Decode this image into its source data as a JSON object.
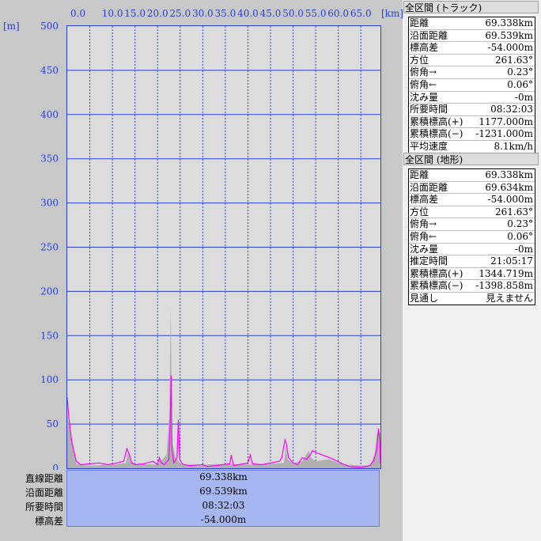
{
  "chart_data": {
    "type": "area",
    "xlabel": "[km]",
    "ylabel": "[m]",
    "xlim": [
      0,
      69.338
    ],
    "ylim": [
      0,
      500
    ],
    "xticks": [
      "0.0",
      "10.0",
      "15.0",
      "20.0",
      "25.0",
      "30.0",
      "35.0",
      "40.0",
      "45.0",
      "50.0",
      "55.0",
      "60.0",
      "65.0"
    ],
    "yticks": [
      "500",
      "450",
      "400",
      "350",
      "300",
      "250",
      "200",
      "150",
      "100",
      "50",
      "0"
    ],
    "grid": true,
    "series": [
      {
        "name": "",
        "color": "#b0b0b0",
        "x": [
          0,
          2,
          5,
          10,
          13,
          13.5,
          14,
          15,
          20,
          22,
          22.6,
          22.9,
          23.2,
          24,
          25,
          26,
          30,
          35,
          40,
          45,
          48,
          48.4,
          48.8,
          50,
          52,
          53.5,
          54,
          55,
          58,
          60,
          62,
          65,
          67,
          68,
          68.6,
          69.338
        ],
        "y": [
          60,
          5,
          3,
          4,
          6,
          20,
          8,
          5,
          4,
          15,
          60,
          185,
          30,
          12,
          6,
          4,
          4,
          5,
          4,
          5,
          6,
          25,
          10,
          6,
          8,
          20,
          12,
          8,
          10,
          6,
          4,
          3,
          3,
          15,
          40,
          40
        ]
      },
      {
        "name": "",
        "color": "#ff00ff",
        "x": [
          0,
          0.3,
          1,
          2,
          3,
          5,
          7,
          9,
          11,
          12.5,
          13.2,
          13.8,
          14.3,
          15,
          17,
          19,
          20,
          20.4,
          20.8,
          21.5,
          22.5,
          22.8,
          23.0,
          23.2,
          23.6,
          24.3,
          24.6,
          24.9,
          25.5,
          26,
          27,
          30,
          31,
          33,
          36,
          36.3,
          36.8,
          38,
          40,
          40.5,
          41,
          43,
          45,
          47,
          47.5,
          48.2,
          48.5,
          49,
          50,
          51,
          52,
          53,
          53.8,
          54.3,
          55,
          57,
          59,
          60.5,
          61.5,
          62.5,
          65,
          67,
          67.8,
          68.5,
          68.9,
          69.2,
          69.338
        ],
        "y": [
          80,
          60,
          30,
          8,
          4,
          5,
          6,
          4,
          6,
          8,
          22,
          15,
          6,
          4,
          5,
          8,
          4,
          12,
          6,
          4,
          10,
          50,
          105,
          20,
          6,
          12,
          55,
          10,
          5,
          4,
          3,
          4,
          2,
          3,
          5,
          15,
          3,
          4,
          6,
          15,
          5,
          4,
          6,
          8,
          12,
          32,
          28,
          12,
          6,
          4,
          12,
          10,
          15,
          20,
          18,
          14,
          10,
          6,
          4,
          2,
          1,
          3,
          8,
          20,
          45,
          30,
          5
        ]
      }
    ]
  },
  "summary": {
    "rows": [
      {
        "label": "直線距離",
        "value": "69.338km"
      },
      {
        "label": "沿面距離",
        "value": "69.539km"
      },
      {
        "label": "所要時間",
        "value": "08:32:03"
      },
      {
        "label": "標高差",
        "value": "-54.000m"
      }
    ]
  },
  "panels": {
    "track": {
      "title": "全区間 (トラック)",
      "rows": [
        {
          "label": "距離",
          "value": "69.338km"
        },
        {
          "label": "沿面距離",
          "value": "69.539km"
        },
        {
          "label": "標高差",
          "value": "-54.000m"
        },
        {
          "label": "方位",
          "value": "261.63°"
        },
        {
          "label": "俯角→",
          "value": "0.23°"
        },
        {
          "label": "俯角←",
          "value": "0.06°"
        },
        {
          "label": "沈み量",
          "value": "-0m"
        },
        {
          "label": "所要時間",
          "value": "08:32:03"
        },
        {
          "label": "累積標高(+)",
          "value": "1177.000m"
        },
        {
          "label": "累積標高(−)",
          "value": "-1231.000m"
        },
        {
          "label": "平均速度",
          "value": "8.1km/h"
        }
      ]
    },
    "terrain": {
      "title": "全区間 (地形)",
      "rows": [
        {
          "label": "距離",
          "value": "69.338km"
        },
        {
          "label": "沿面距離",
          "value": "69.634km"
        },
        {
          "label": "標高差",
          "value": "-54.000m"
        },
        {
          "label": "方位",
          "value": "261.63°"
        },
        {
          "label": "俯角→",
          "value": "0.23°"
        },
        {
          "label": "俯角←",
          "value": "0.06°"
        },
        {
          "label": "沈み量",
          "value": "-0m"
        },
        {
          "label": "推定時間",
          "value": "21:05:17"
        },
        {
          "label": "累積標高(+)",
          "value": "1344.719m"
        },
        {
          "label": "累積標高(−)",
          "value": "-1398.858m"
        },
        {
          "label": "見通し",
          "value": "見えません"
        }
      ]
    }
  }
}
